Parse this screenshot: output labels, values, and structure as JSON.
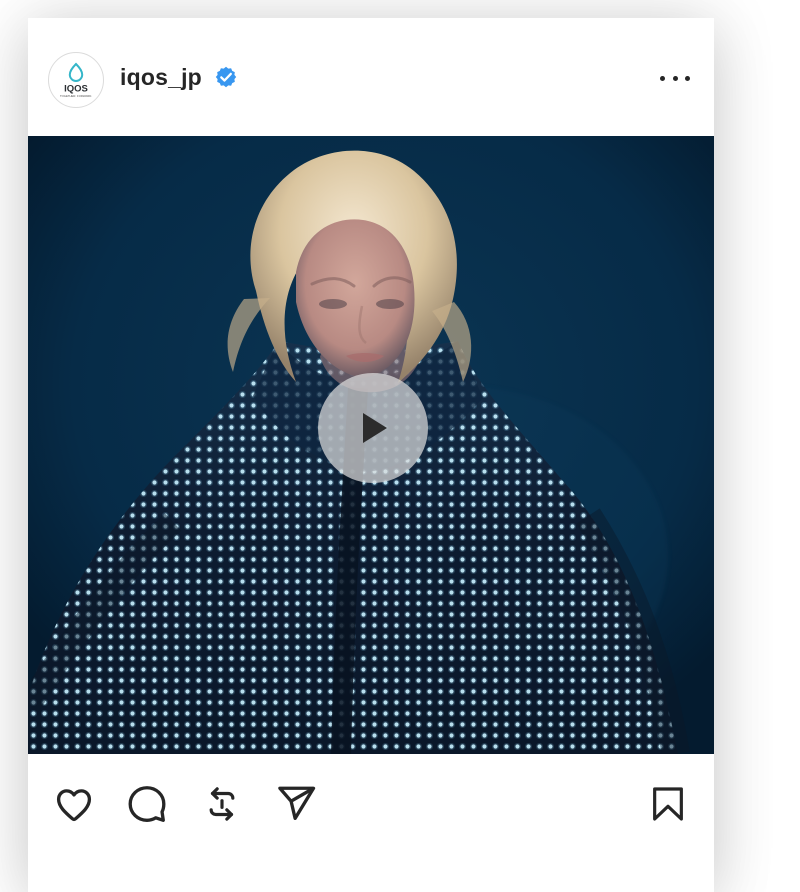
{
  "post": {
    "username": "iqos_jp",
    "verified": true,
    "more_label": "More options",
    "media_type": "video",
    "play_label": "Play",
    "colors": {
      "media_background": "#06233b",
      "verified_badge": "#3897f0",
      "icon": "#262626",
      "brand_teal": "#35b6c9"
    }
  },
  "avatar": {
    "logo_text": "IQOS",
    "tagline": "TOGETHER. FORWARD."
  },
  "actions": {
    "like": "heart-icon",
    "comment": "comment-icon",
    "repost": "repost-icon",
    "share": "send-icon",
    "save": "bookmark-icon"
  }
}
